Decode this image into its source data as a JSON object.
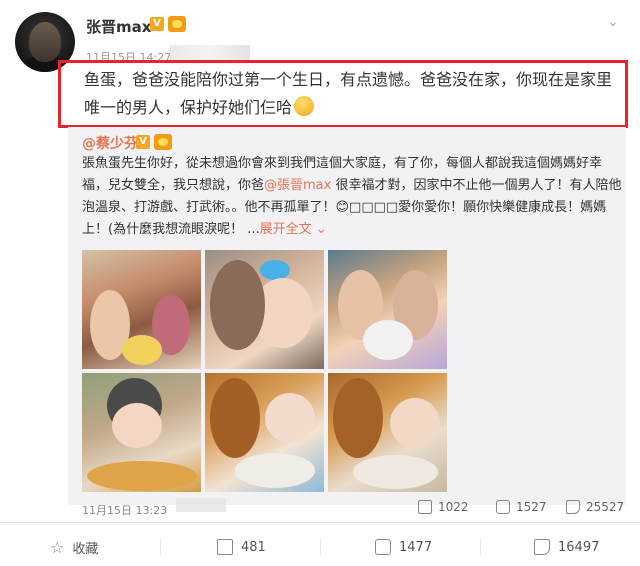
{
  "post": {
    "author": "张晋max",
    "verified_badge": "V",
    "time": "11月15日 14:27",
    "text": "鱼蛋，爸爸没能陪你过第一个生日，有点遗憾。爸爸没在家，你现在是家里唯一的男人，保护好她们仨哈"
  },
  "repost": {
    "author": "@蔡少芬",
    "verified_badge": "V",
    "text_before": "張魚蛋先生你好，從未想過你會來到我們這個大家庭，有了你，每個人都說我這個媽媽好幸福，兒女雙全，我只想說，你爸",
    "mention": "@張晉max",
    "text_after": " 很幸福才對，因家中不止他一個男人了！有人陪他泡溫泉、打游戲、打武術。。他不再孤單了！😊□□□□愛你愛你！願你快樂健康成長！媽媽上！(為什麼我想流眼淚呢！ ...",
    "expand_label": "展开全文 ⌄",
    "time": "11月15日 13:23",
    "metrics": {
      "reposts": "1022",
      "comments": "1527",
      "likes": "25527"
    }
  },
  "actions": {
    "favorite": "收藏",
    "repost": "481",
    "comment": "1477",
    "like": "16497"
  },
  "icons": {
    "favorite": "star-icon",
    "repost": "share-icon",
    "comment": "comment-icon",
    "like": "thumbs-up-icon",
    "menu": "chevron-down-icon"
  },
  "colors": {
    "highlight_border": "#e8232d",
    "link": "#eb7350",
    "badge": "#f5a623",
    "repost_bg": "#f2f2f5"
  }
}
